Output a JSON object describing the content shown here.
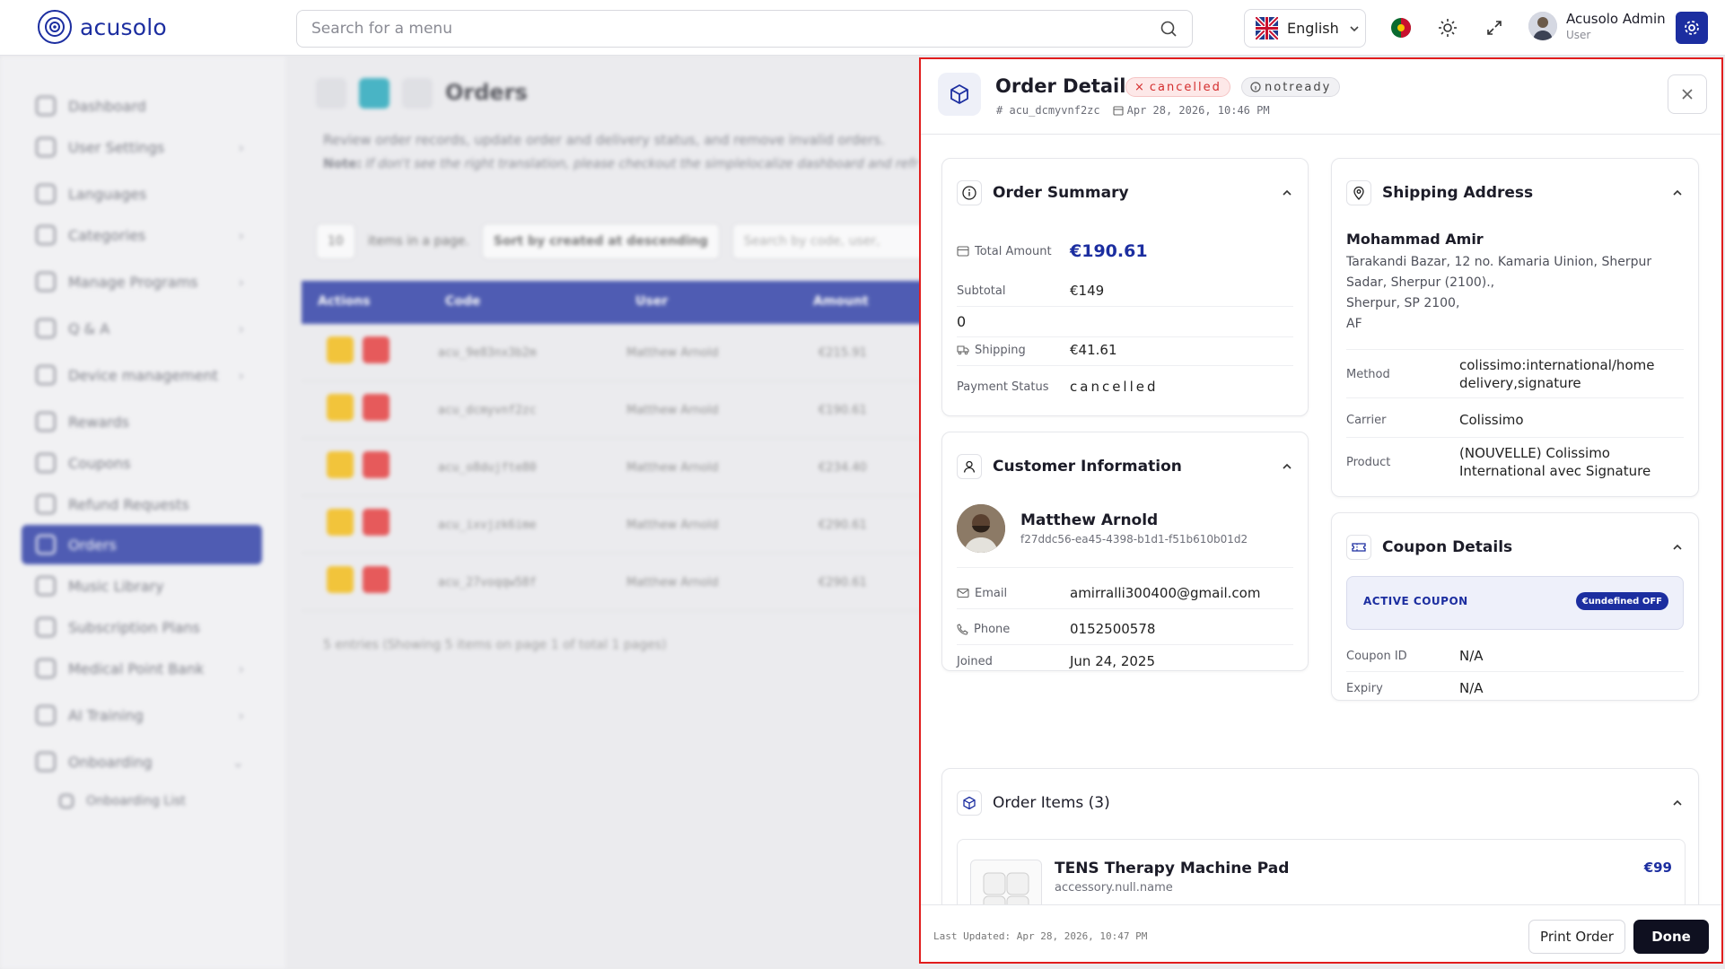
{
  "header": {
    "logo_text": "acusolo",
    "search_placeholder": "Search for a menu",
    "language": "English",
    "user_name": "Acusolo Admin",
    "user_role": "User"
  },
  "sidebar": {
    "items": [
      {
        "label": "Dashboard"
      },
      {
        "label": "User Settings"
      },
      {
        "label": "Languages"
      },
      {
        "label": "Categories"
      },
      {
        "label": "Manage Programs"
      },
      {
        "label": "Q & A"
      },
      {
        "label": "Device management"
      },
      {
        "label": "Rewards"
      },
      {
        "label": "Coupons"
      },
      {
        "label": "Refund Requests"
      },
      {
        "label": "Orders"
      },
      {
        "label": "Music Library"
      },
      {
        "label": "Subscription Plans"
      },
      {
        "label": "Medical Point Bank"
      },
      {
        "label": "AI Training"
      },
      {
        "label": "Onboarding"
      },
      {
        "label": "Onboarding List"
      }
    ]
  },
  "orders_page": {
    "title": "Orders",
    "description": "Review order records, update order and delivery status, and remove invalid orders.",
    "note_label": "Note:",
    "note_text": "If don't see the right translation, please checkout the simplelocalize dashboard and refr",
    "page_size": "10",
    "page_size_label": "items in a page.",
    "sort": "Sort by created at descending",
    "search_placeholder": "Search by code, user,",
    "columns": [
      "Actions",
      "Code",
      "User",
      "Amount"
    ],
    "rows": [
      {
        "code": "acu_9e83nx3b2m",
        "user": "Matthew Arnold",
        "amount": "€215.91"
      },
      {
        "code": "acu_dcmyvnf2zc",
        "user": "Matthew Arnold",
        "amount": "€190.61"
      },
      {
        "code": "acu_o8dujfte80",
        "user": "Matthew Arnold",
        "amount": "€234.40"
      },
      {
        "code": "acu_ixvjzk6ime",
        "user": "Matthew Arnold",
        "amount": "€290.61"
      },
      {
        "code": "acu_27voqqw58f",
        "user": "Matthew Arnold",
        "amount": "€290.61"
      }
    ],
    "entries": "5 entries (Showing 5 items on page 1 of total 1 pages)"
  },
  "modal": {
    "title": "Order Details",
    "status_badge": "cancelled",
    "delivery_badge": "notready",
    "order_code": "acu_dcmyvnf2zc",
    "date": "Apr 28, 2026, 10:46 PM",
    "summary": {
      "title": "Order Summary",
      "total_label": "Total Amount",
      "total_value": "€190.61",
      "subtotal_label": "Subtotal",
      "subtotal_value": "€149",
      "stray": "0",
      "shipping_label": "Shipping",
      "shipping_value": "€41.61",
      "payment_label": "Payment Status",
      "payment_value": "cancelled"
    },
    "customer": {
      "title": "Customer Information",
      "name": "Matthew Arnold",
      "id": "f27ddc56-ea45-4398-b1d1-f51b610b01d2",
      "email_label": "Email",
      "email_value": "amirralli300400@gmail.com",
      "phone_label": "Phone",
      "phone_value": "0152500578",
      "joined_label": "Joined",
      "joined_value": "Jun 24, 2025"
    },
    "shipping": {
      "title": "Shipping Address",
      "name": "Mohammad Amir",
      "addr1": "Tarakandi Bazar, 12 no. Kamaria Uinion, Sherpur",
      "addr2": "Sadar, Sherpur (2100).,",
      "addr3": "Sherpur, SP 2100,",
      "addr4": "AF",
      "method_label": "Method",
      "method_value": "colissimo:international/home delivery,signature",
      "carrier_label": "Carrier",
      "carrier_value": "Colissimo",
      "product_label": "Product",
      "product_value": "(NOUVELLE) Colissimo International avec Signature"
    },
    "coupon": {
      "title": "Coupon Details",
      "active_label": "ACTIVE COUPON",
      "badge": "€undefined OFF",
      "id_label": "Coupon ID",
      "id_value": "N/A",
      "expiry_label": "Expiry",
      "expiry_value": "N/A"
    },
    "items": {
      "title": "Order Items (3)",
      "first_name": "TENS Therapy Machine Pad",
      "first_sub": "accessory.null.name",
      "first_price": "€99"
    },
    "footer": {
      "updated": "Last Updated: Apr 28, 2026, 10:47 PM",
      "print": "Print Order",
      "done": "Done"
    }
  },
  "colors": {
    "brand": "#1c2ea0",
    "danger": "#e11d1d",
    "edit": "#f5b800"
  }
}
